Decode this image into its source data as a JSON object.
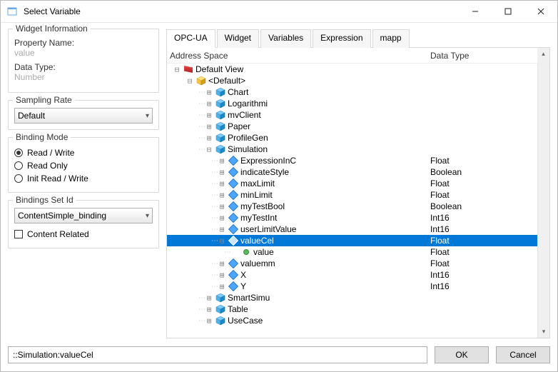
{
  "window": {
    "title": "Select Variable"
  },
  "widget_info": {
    "group_title": "Widget Information",
    "prop_name_label": "Property Name:",
    "prop_name_value": "value",
    "data_type_label": "Data Type:",
    "data_type_value": "Number"
  },
  "sampling": {
    "group_title": "Sampling Rate",
    "value": "Default"
  },
  "binding_mode": {
    "group_title": "Binding Mode",
    "options": [
      "Read / Write",
      "Read Only",
      "Init Read / Write"
    ],
    "selected": 0
  },
  "bindings_set": {
    "group_title": "Bindings Set Id",
    "value": "ContentSimple_binding",
    "content_related_label": "Content Related"
  },
  "tabs": [
    "OPC-UA",
    "Widget",
    "Variables",
    "Expression",
    "mapp"
  ],
  "active_tab": 0,
  "columns": {
    "c1": "Address Space",
    "c2": "Data Type"
  },
  "tree": [
    {
      "indent": 0,
      "exp": "-",
      "icon": "view",
      "label": "Default View",
      "type": ""
    },
    {
      "indent": 1,
      "exp": "-",
      "icon": "pkg",
      "label": "<Default>",
      "type": ""
    },
    {
      "indent": 2,
      "exp": "+",
      "icon": "cube",
      "label": "Chart",
      "type": ""
    },
    {
      "indent": 2,
      "exp": "+",
      "icon": "cube",
      "label": "Logarithmi",
      "type": ""
    },
    {
      "indent": 2,
      "exp": "+",
      "icon": "cube",
      "label": "mvClient",
      "type": ""
    },
    {
      "indent": 2,
      "exp": "+",
      "icon": "cube",
      "label": "Paper",
      "type": ""
    },
    {
      "indent": 2,
      "exp": "+",
      "icon": "cube",
      "label": "ProfileGen",
      "type": ""
    },
    {
      "indent": 2,
      "exp": "-",
      "icon": "cube",
      "label": "Simulation",
      "type": ""
    },
    {
      "indent": 3,
      "exp": "+",
      "icon": "var",
      "label": "ExpressionInC",
      "type": "Float"
    },
    {
      "indent": 3,
      "exp": "+",
      "icon": "var",
      "label": "indicateStyle",
      "type": "Boolean"
    },
    {
      "indent": 3,
      "exp": "+",
      "icon": "var",
      "label": "maxLimit",
      "type": "Float"
    },
    {
      "indent": 3,
      "exp": "+",
      "icon": "var",
      "label": "minLimit",
      "type": "Float"
    },
    {
      "indent": 3,
      "exp": "+",
      "icon": "var",
      "label": "myTestBool",
      "type": "Boolean"
    },
    {
      "indent": 3,
      "exp": "+",
      "icon": "var",
      "label": "myTestInt",
      "type": "Int16"
    },
    {
      "indent": 3,
      "exp": "+",
      "icon": "var",
      "label": "userLimitValue",
      "type": "Int16"
    },
    {
      "indent": 3,
      "exp": "-",
      "icon": "var",
      "label": "valueCel",
      "type": "Float",
      "selected": true
    },
    {
      "indent": 4,
      "exp": "",
      "icon": "scalar",
      "label": "value",
      "type": "Float"
    },
    {
      "indent": 3,
      "exp": "+",
      "icon": "var",
      "label": "valuemm",
      "type": "Float"
    },
    {
      "indent": 3,
      "exp": "+",
      "icon": "var",
      "label": "X",
      "type": "Int16"
    },
    {
      "indent": 3,
      "exp": "+",
      "icon": "var",
      "label": "Y",
      "type": "Int16"
    },
    {
      "indent": 2,
      "exp": "+",
      "icon": "cube",
      "label": "SmartSimu",
      "type": ""
    },
    {
      "indent": 2,
      "exp": "+",
      "icon": "cube",
      "label": "Table",
      "type": ""
    },
    {
      "indent": 2,
      "exp": "+",
      "icon": "cube",
      "label": "UseCase",
      "type": ""
    }
  ],
  "selected_path": "::Simulation:valueCel",
  "buttons": {
    "ok": "OK",
    "cancel": "Cancel"
  }
}
